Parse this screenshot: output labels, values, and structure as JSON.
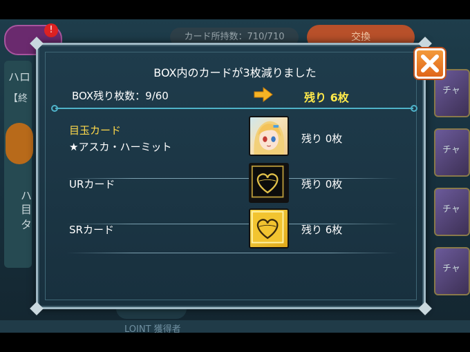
{
  "background": {
    "card_count": "カード所持数：710/710",
    "exchange_button": "交換",
    "left_texts": [
      "ハロ",
      "【終",
      "ハ",
      "目",
      "タ"
    ],
    "right_texts": [
      "チャ",
      "チャ",
      "チャ",
      "チャ"
    ],
    "bottom_text": "LOINT 獲得者"
  },
  "dialog": {
    "title": "BOX内のカードが3枚減りました",
    "box_remaining_label": "BOX残り枚数：9/60",
    "box_remaining_after": "残り 6枚",
    "rows": [
      {
        "label": "目玉カード",
        "sublabel": "★アスカ・ハーミット",
        "count": "残り 0枚"
      },
      {
        "label": "URカード",
        "count": "残り 0枚"
      },
      {
        "label": "SRカード",
        "count": "残り 6枚"
      }
    ],
    "colors": {
      "highlight": "#ffe94a",
      "accent_orange": "#f39a3a",
      "frame": "#9fb8c4"
    }
  },
  "icons": {
    "close": "close-x-icon",
    "arrow": "arrow-right-icon"
  }
}
